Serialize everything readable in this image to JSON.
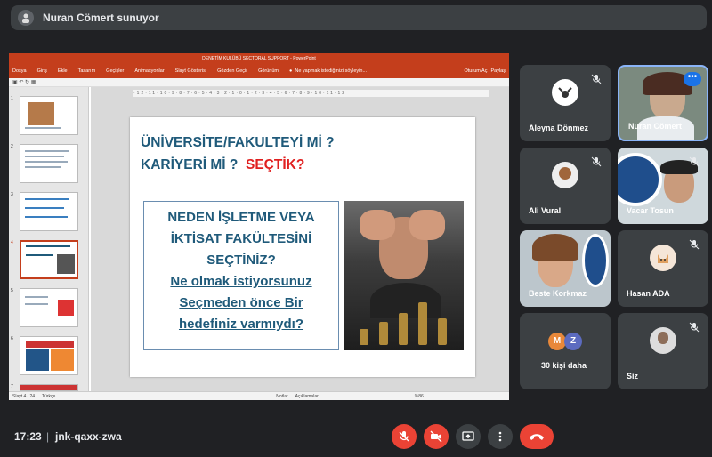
{
  "top_bar": {
    "presenter_text": "Nuran Cömert sunuyor"
  },
  "ppt": {
    "window_title": "DENETİM KULÜBÜ  SECTORAL SUPPORT - PowerPoint",
    "menu": [
      "Dosya",
      "Giriş",
      "Ekle",
      "Tasarım",
      "Geçişler",
      "Animasyonlar",
      "Slayt Gösterisi",
      "Gözden Geçir",
      "Görünüm"
    ],
    "tell_me": "Ne yapmak istediğinizi söyleyin...",
    "sign_in": "Oturum Aç",
    "share": "Paylaş",
    "thumb_numbers": [
      "1",
      "2",
      "3",
      "4",
      "5",
      "6",
      "7"
    ],
    "selected_slide": 4,
    "ruler_text": "·12·11·10·9·8·7·6·5·4·3·2·1·0·1·2·3·4·5·6·7·8·9·10·11·12",
    "status_slide": "Slayt 4 / 24",
    "status_lang": "Türkçe",
    "status_notes": "Notlar",
    "status_comments": "Açıklamalar",
    "status_zoom": "%86"
  },
  "slide": {
    "heading_line1": "ÜNİVERSİTE/FAKULTEYİ Mİ ?",
    "heading_line2": "KARİYERİ Mİ ?",
    "heading_red": "SEÇTİK?",
    "box_lines": [
      "NEDEN İŞLETME   VEYA",
      "İKTİSAT  FAKÜLTESİNİ",
      "SEÇTİNİZ?",
      "Ne olmak  istiyorsunuz",
      "Seçmeden önce Bir",
      "hedefiniz varmıydı?"
    ]
  },
  "participants": [
    {
      "name": "Aleyna Dönmez"
    },
    {
      "name": "Nuran Cömert"
    },
    {
      "name": "Ali Vural"
    },
    {
      "name": "Vacar Tosun"
    },
    {
      "name": "Beste Korkmaz"
    },
    {
      "name": "Hasan ADA"
    },
    {
      "name": "30 kişi daha",
      "badges": [
        "M",
        "Z"
      ]
    },
    {
      "name": "Siz"
    }
  ],
  "colors": {
    "accent_red": "#ea4335",
    "tile_bg": "#3c4043",
    "ppt_red": "#c43e1c",
    "blue": "#1a73e8"
  },
  "bottom": {
    "time": "17:23",
    "separator": "|",
    "meeting_code": "jnk-qaxx-zwa"
  }
}
